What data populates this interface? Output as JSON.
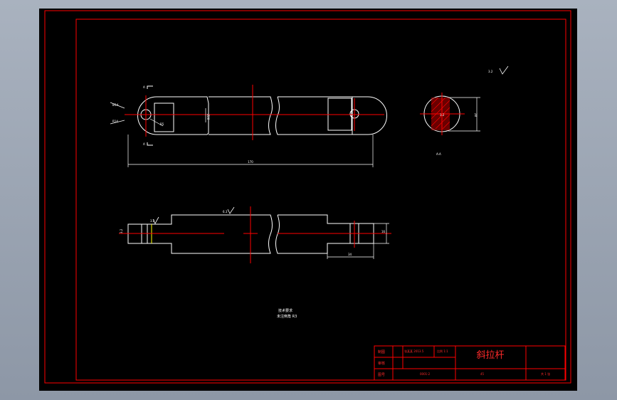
{
  "sheet": {
    "title_cn": "斜拉杆",
    "note_line1": "技术要求",
    "note_line2": "未注倒角 R3",
    "roughness_global": "3.2",
    "section_label": "A-A",
    "section_mark_top": "A",
    "section_mark_bottom": "A"
  },
  "dimensions": {
    "overall_length": "170",
    "hole_dia": "Ø14",
    "end_radius": "R14",
    "corner_radius": "R5",
    "body_height": "Ø28",
    "section_height": "28",
    "bottom_thickness": "16",
    "shoulder_length": "34",
    "rough_top": "6.3",
    "rough_end": "3.2",
    "rough_left": "3.2",
    "rough_section": "3.2"
  },
  "title_block": {
    "designer_label": "制图",
    "designer_name": "张某某 2013.5",
    "material_label": "审核",
    "scale_label": "比例 1:1",
    "check_label": "审核",
    "drawing_no_label": "图号",
    "drawing_no": "0001-2",
    "sheet_count": "共 1 张",
    "material": "45"
  },
  "colors": {
    "frame": "#ff0000",
    "outline": "#ffffff",
    "centerline": "#ff0000",
    "hatch": "#ff0000",
    "accent": "#ffff00"
  }
}
